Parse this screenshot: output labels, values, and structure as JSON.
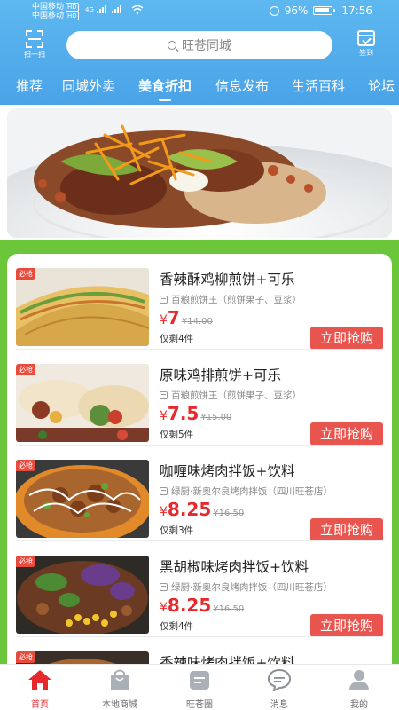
{
  "status_bar": {
    "carrier1": "中国移动",
    "carrier2": "中国移动",
    "hd": "HD",
    "network": "4G",
    "battery": "96%",
    "time": "17:56"
  },
  "header": {
    "scan_label": "扫一扫",
    "search_placeholder": "旺苍同城",
    "signin_label": "签到",
    "tabs": [
      {
        "label": "推荐"
      },
      {
        "label": "同城外卖"
      },
      {
        "label": "美食折扣"
      },
      {
        "label": "信息发布"
      },
      {
        "label": "生活百科"
      },
      {
        "label": "论坛"
      }
    ],
    "active_tab": "美食折扣"
  },
  "colors": {
    "header_blue": "#4aa3e8",
    "accent_red": "#e8292c",
    "button_red": "#e8554f",
    "list_green": "#6cc63a"
  },
  "deals": [
    {
      "badge": "必抢",
      "title": "香辣酥鸡柳煎饼+可乐",
      "shop": "百粮煎饼王（煎饼果子、豆浆）",
      "price_symbol": "¥",
      "price": "7",
      "original_price": "¥14.00",
      "remaining": "仅剩4件",
      "button": "立即抢购",
      "image": "wrap-icon"
    },
    {
      "badge": "必抢",
      "title": "原味鸡排煎饼+可乐",
      "shop": "百粮煎饼王（煎饼果子、豆浆）",
      "price_symbol": "¥",
      "price": "7.5",
      "original_price": "¥15.00",
      "remaining": "仅剩5件",
      "button": "立即抢购",
      "image": "burrito-icon"
    },
    {
      "badge": "必抢",
      "title": "咖喱味烤肉拌饭+饮料",
      "shop": "绿厨·新奥尔良烤肉拌饭（四川旺苍店）",
      "price_symbol": "¥",
      "price": "8.25",
      "original_price": "¥16.50",
      "remaining": "仅剩3件",
      "button": "立即抢购",
      "image": "rice-bowl-icon"
    },
    {
      "badge": "必抢",
      "title": "黑胡椒味烤肉拌饭+饮料",
      "shop": "绿厨·新奥尔良烤肉拌饭（四川旺苍店）",
      "price_symbol": "¥",
      "price": "8.25",
      "original_price": "¥16.50",
      "remaining": "仅剩4件",
      "button": "立即抢购",
      "image": "salad-bowl-icon"
    },
    {
      "badge": "必抢",
      "title": "香辣味烤肉拌饭+饮料",
      "image": "rice-bowl-icon"
    }
  ],
  "bottom_nav": [
    {
      "label": "首页",
      "icon": "home-icon",
      "active": true
    },
    {
      "label": "本地商城",
      "icon": "shopping-bag-icon",
      "active": false
    },
    {
      "label": "旺苍圈",
      "icon": "circle-feed-icon",
      "active": false
    },
    {
      "label": "消息",
      "icon": "message-icon",
      "active": false
    },
    {
      "label": "我的",
      "icon": "user-icon",
      "active": false
    }
  ]
}
